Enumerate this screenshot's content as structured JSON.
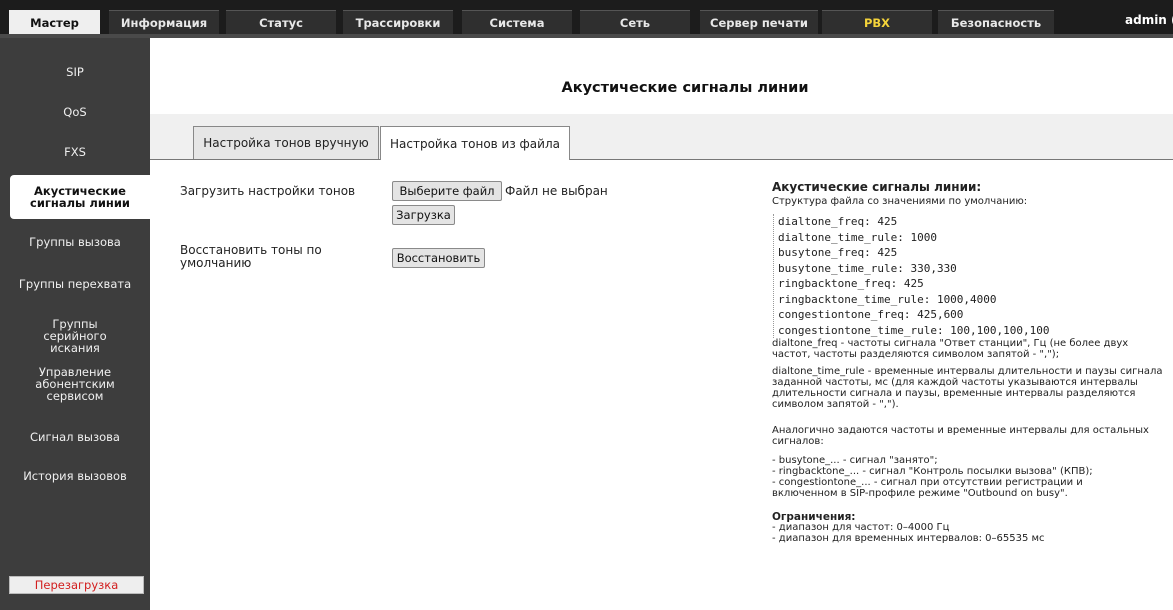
{
  "topnav": {
    "tabs": [
      "Мастер",
      "Информация",
      "Статус",
      "Трассировки",
      "Система",
      "Сеть",
      "Сервер печати",
      "PBX",
      "Безопасность"
    ],
    "user": "admin ("
  },
  "sidebar": {
    "items": [
      "SIP",
      "QoS",
      "FXS",
      "Акустические сигналы линии",
      "Группы вызова",
      "Группы перехвата",
      "Группы серийного искания",
      "Управление абонентским сервисом",
      "Сигнал вызова",
      "История вызовов"
    ],
    "active": "Акустические сигналы линии",
    "reboot": "Перезагрузка"
  },
  "main": {
    "title": "Акустические сигналы линии",
    "tabs": [
      "Настройка тонов вручную",
      "Настройка тонов из файла"
    ],
    "active_tab": "Настройка тонов из файла",
    "upload_label": "Загрузить настройки тонов",
    "choose_file_button": "Выберите файл",
    "no_file_text": "Файл не выбран",
    "upload_button": "Загрузка",
    "restore_label": "Восстановить тоны по умолчанию",
    "restore_button": "Восстановить"
  },
  "info": {
    "title": "Акустические сигналы линии:",
    "subtitle": "Структура файла со значениями по умолчанию:",
    "code_lines": [
      "dialtone_freq: 425",
      "dialtone_time_rule: 1000",
      "busytone_freq: 425",
      "busytone_time_rule: 330,330",
      "ringbacktone_freq: 425",
      "ringbacktone_time_rule: 1000,4000",
      "congestiontone_freq: 425,600",
      "congestiontone_time_rule: 100,100,100,100"
    ],
    "desc1": "dialtone_freq - частоты сигнала \"Ответ станции\", Гц (не более двух частот, частоты разделяются символом запятой - \",\");",
    "desc2": "dialtone_time_rule - временные интервалы длительности и паузы сигнала заданной частоты, мс (для каждой частоты указываются интервалы длительности сигнала и паузы, временные интервалы разделяются символом запятой - \",\").",
    "desc3": "Аналогично задаются частоты и временные интервалы для остальных сигналов:",
    "list_lines": [
      "- busytone_... - сигнал \"занято\";",
      "- ringbacktone_... - сигнал \"Контроль посылки вызова\" (КПВ);",
      "- congestiontone_... - сигнал при отсутствии регистрации и",
      "включенном в SIP-профиле режиме \"Outbound on busy\"."
    ],
    "limits_title": "Ограничения:",
    "limits": [
      "- диапазон для частот: 0–4000 Гц",
      "- диапазон для временных интервалов: 0–65535 мс"
    ]
  }
}
